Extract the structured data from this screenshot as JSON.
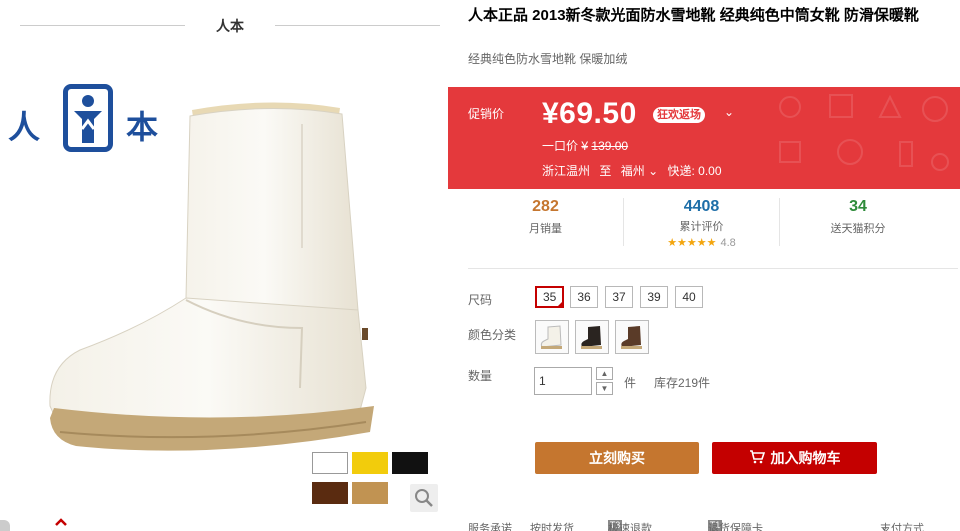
{
  "gallery": {
    "brand_header": "人本",
    "logo": {
      "left_char": "人",
      "right_char": "本"
    },
    "swatch_colors": [
      "#ffffff",
      "#f2cc0c",
      "#111111",
      "#5a2b10",
      "#c19352"
    ],
    "zoom_icon": "magnifier-icon",
    "up_icon": "chevron-up-icon"
  },
  "product": {
    "title": "人本正品 2013新冬款光面防水雪地靴 经典纯色中筒女靴 防滑保暖靴",
    "subtitle": "经典纯色防水雪地靴 保暖加绒"
  },
  "price": {
    "label": "促销价",
    "value": "¥69.50",
    "promo_tag": "狂欢返场",
    "promo_chevron": "⌄",
    "orig_label": "一口价",
    "orig_currency": "¥",
    "orig_value": "139.00",
    "ship_from": "浙江温州",
    "ship_to_word": "至",
    "ship_to": "福州",
    "ship_chevron": "⌄",
    "ship_fee": "快递: 0.00"
  },
  "stats": {
    "sales": {
      "num": "282",
      "label": "月销量",
      "color": "#c5762f"
    },
    "reviews": {
      "num": "4408",
      "label": "累计评价",
      "stars": "★★★★★",
      "score": "4.8",
      "color": "#1e6ea8"
    },
    "points": {
      "num": "34",
      "label": "送天猫积分",
      "color": "#2e8b3a"
    }
  },
  "options": {
    "size_label": "尺码",
    "sizes": [
      "35",
      "36",
      "37",
      "39",
      "40"
    ],
    "selected_size": "35",
    "color_label": "颜色分类",
    "colors": [
      "white",
      "black",
      "brown"
    ],
    "qty_label": "数量",
    "qty_value": "1",
    "qty_unit": "件",
    "stock": "库存219件",
    "up_arrow": "▲",
    "down_arrow": "▼"
  },
  "actions": {
    "buy_label": "立刻购买",
    "cart_label": "加入购物车"
  },
  "services": {
    "label": "服务承诺",
    "items": [
      "按时发货",
      "极速退款",
      "退货保障卡"
    ],
    "icons": [
      "T3",
      "T1"
    ],
    "pay_label": "支付方式",
    "pay_chevron": "⌄"
  },
  "theme": {
    "accent": "#c40000",
    "price_bg": "#e4393c",
    "buy_bg": "#c5762f"
  }
}
